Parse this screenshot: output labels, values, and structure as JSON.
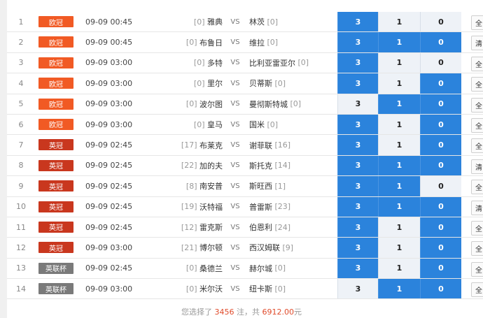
{
  "vs_label": "VS",
  "colors": {
    "euro": "#f15a24",
    "epl": "#c9371e",
    "cup": "#7a7a7a",
    "selected": "#2b83dc"
  },
  "rows": [
    {
      "idx": "1",
      "league": "欧冠",
      "lc": "euro",
      "time": "09-09 00:45",
      "home_rank": "[0]",
      "home": "雅典",
      "away": "林茨",
      "away_rank": "[0]",
      "o3": "3",
      "o1": "1",
      "o0": "0",
      "s3": true,
      "s1": false,
      "s0": false,
      "act": "全"
    },
    {
      "idx": "2",
      "league": "欧冠",
      "lc": "euro",
      "time": "09-09 00:45",
      "home_rank": "[0]",
      "home": "布鲁日",
      "away": "维拉",
      "away_rank": "[0]",
      "o3": "3",
      "o1": "1",
      "o0": "0",
      "s3": true,
      "s1": true,
      "s0": true,
      "act": "清"
    },
    {
      "idx": "3",
      "league": "欧冠",
      "lc": "euro",
      "time": "09-09 03:00",
      "home_rank": "[0]",
      "home": "多特",
      "away": "比利亚雷亚尔",
      "away_rank": "[0]",
      "o3": "3",
      "o1": "1",
      "o0": "0",
      "s3": true,
      "s1": false,
      "s0": false,
      "act": "全"
    },
    {
      "idx": "4",
      "league": "欧冠",
      "lc": "euro",
      "time": "09-09 03:00",
      "home_rank": "[0]",
      "home": "里尔",
      "away": "贝蒂斯",
      "away_rank": "[0]",
      "o3": "3",
      "o1": "1",
      "o0": "0",
      "s3": true,
      "s1": false,
      "s0": true,
      "act": "全"
    },
    {
      "idx": "5",
      "league": "欧冠",
      "lc": "euro",
      "time": "09-09 03:00",
      "home_rank": "[0]",
      "home": "波尔图",
      "away": "曼彻斯特城",
      "away_rank": "[0]",
      "o3": "3",
      "o1": "1",
      "o0": "0",
      "s3": false,
      "s1": true,
      "s0": true,
      "act": "全"
    },
    {
      "idx": "6",
      "league": "欧冠",
      "lc": "euro",
      "time": "09-09 03:00",
      "home_rank": "[0]",
      "home": "皇马",
      "away": "国米",
      "away_rank": "[0]",
      "o3": "3",
      "o1": "1",
      "o0": "0",
      "s3": true,
      "s1": false,
      "s0": true,
      "act": "全"
    },
    {
      "idx": "7",
      "league": "英冠",
      "lc": "epl",
      "time": "09-09 02:45",
      "home_rank": "[17]",
      "home": "布莱克",
      "away": "谢菲联",
      "away_rank": "[16]",
      "o3": "3",
      "o1": "1",
      "o0": "0",
      "s3": true,
      "s1": false,
      "s0": true,
      "act": "全"
    },
    {
      "idx": "8",
      "league": "英冠",
      "lc": "epl",
      "time": "09-09 02:45",
      "home_rank": "[22]",
      "home": "加的夫",
      "away": "斯托克",
      "away_rank": "[14]",
      "o3": "3",
      "o1": "1",
      "o0": "0",
      "s3": true,
      "s1": true,
      "s0": true,
      "act": "清"
    },
    {
      "idx": "9",
      "league": "英冠",
      "lc": "epl",
      "time": "09-09 02:45",
      "home_rank": "[8]",
      "home": "南安普",
      "away": "斯旺西",
      "away_rank": "[1]",
      "o3": "3",
      "o1": "1",
      "o0": "0",
      "s3": true,
      "s1": true,
      "s0": false,
      "act": "全"
    },
    {
      "idx": "10",
      "league": "英冠",
      "lc": "epl",
      "time": "09-09 02:45",
      "home_rank": "[19]",
      "home": "沃特福",
      "away": "普雷斯",
      "away_rank": "[23]",
      "o3": "3",
      "o1": "1",
      "o0": "0",
      "s3": true,
      "s1": true,
      "s0": true,
      "act": "清"
    },
    {
      "idx": "11",
      "league": "英冠",
      "lc": "epl",
      "time": "09-09 02:45",
      "home_rank": "[12]",
      "home": "雷克斯",
      "away": "伯恩利",
      "away_rank": "[24]",
      "o3": "3",
      "o1": "1",
      "o0": "0",
      "s3": true,
      "s1": false,
      "s0": true,
      "act": "全"
    },
    {
      "idx": "12",
      "league": "英冠",
      "lc": "epl",
      "time": "09-09 03:00",
      "home_rank": "[21]",
      "home": "博尔顿",
      "away": "西汉姆联",
      "away_rank": "[9]",
      "o3": "3",
      "o1": "1",
      "o0": "0",
      "s3": true,
      "s1": false,
      "s0": true,
      "act": "全"
    },
    {
      "idx": "13",
      "league": "英联杯",
      "lc": "cup",
      "time": "09-09 02:45",
      "home_rank": "[0]",
      "home": "桑德兰",
      "away": "赫尔城",
      "away_rank": "[0]",
      "o3": "3",
      "o1": "1",
      "o0": "0",
      "s3": true,
      "s1": false,
      "s0": true,
      "act": "全"
    },
    {
      "idx": "14",
      "league": "英联杯",
      "lc": "cup",
      "time": "09-09 03:00",
      "home_rank": "[0]",
      "home": "米尔沃",
      "away": "纽卡斯",
      "away_rank": "[0]",
      "o3": "3",
      "o1": "1",
      "o0": "0",
      "s3": false,
      "s1": true,
      "s0": true,
      "act": "全"
    }
  ],
  "summary": {
    "prefix": "您选择了 ",
    "count": "3456",
    "mid": " 注，共 ",
    "amount": "6912.00",
    "suffix": "元"
  }
}
